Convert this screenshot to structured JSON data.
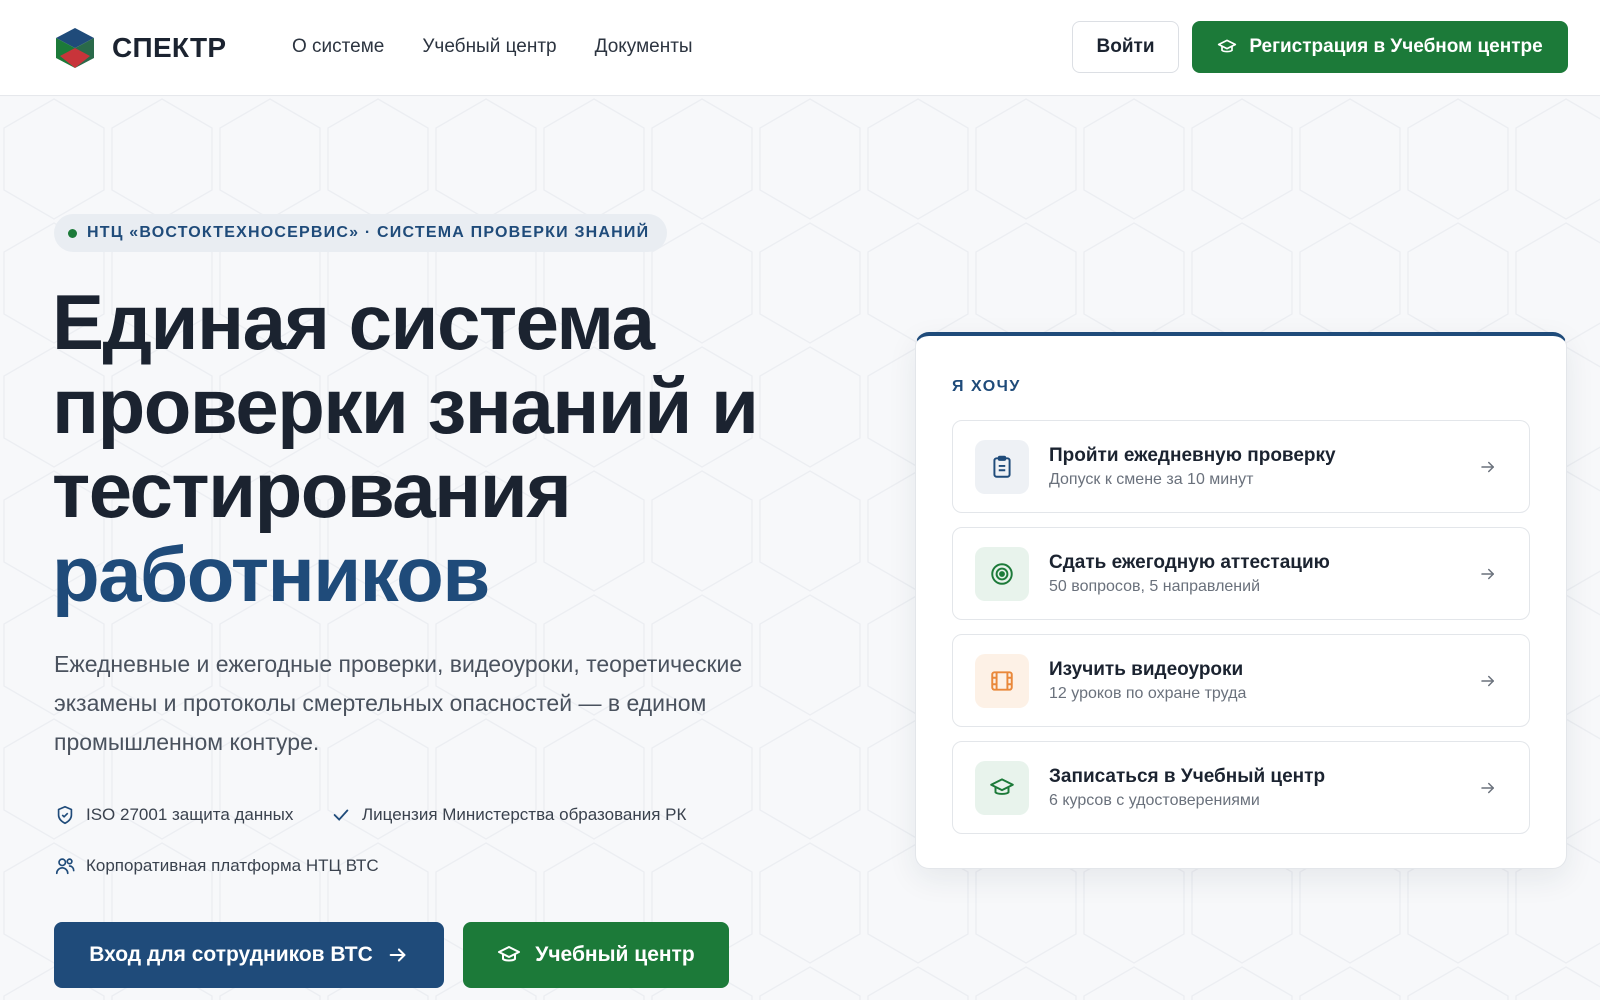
{
  "header": {
    "brand": "СПЕКТР",
    "nav": [
      "О системе",
      "Учебный центр",
      "Документы"
    ],
    "login_label": "Войти",
    "register_label": "Регистрация в Учебном центре"
  },
  "hero": {
    "badge": "НТЦ «ВОСТОКТЕХНОСЕРВИС» · СИСТЕМА ПРОВЕРКИ ЗНАНИЙ",
    "headline_line1": "Единая система",
    "headline_line2": "проверки знаний и",
    "headline_line3": "тестирования",
    "headline_accent": "работников",
    "subtitle": "Ежедневные и ежегодные проверки, видеоуроки, теоретические экзамены и протоколы смертельных опасностей — в едином промышленном контуре.",
    "features": [
      "ISO 27001 защита данных",
      "Лицензия Министерства образования РК",
      "Корпоративная платформа НТЦ ВТС"
    ],
    "cta_primary": "Вход для сотрудников ВТС",
    "cta_secondary": "Учебный центр"
  },
  "card": {
    "title": "Я ХОЧУ",
    "options": [
      {
        "title": "Пройти ежедневную проверку",
        "subtitle": "Допуск к смене за 10 минут",
        "icon": "clipboard-icon"
      },
      {
        "title": "Сдать ежегодную аттестацию",
        "subtitle": "50 вопросов, 5 направлений",
        "icon": "target-icon"
      },
      {
        "title": "Изучить видеоуроки",
        "subtitle": "12 уроков по охране труда",
        "icon": "film-icon"
      },
      {
        "title": "Записаться в Учебный центр",
        "subtitle": "6 курсов с удостоверениями",
        "icon": "graduation-cap-icon"
      }
    ]
  },
  "colors": {
    "brand_blue": "#1f4b7a",
    "brand_green": "#1c7a39",
    "accent_orange": "#e9883a"
  }
}
